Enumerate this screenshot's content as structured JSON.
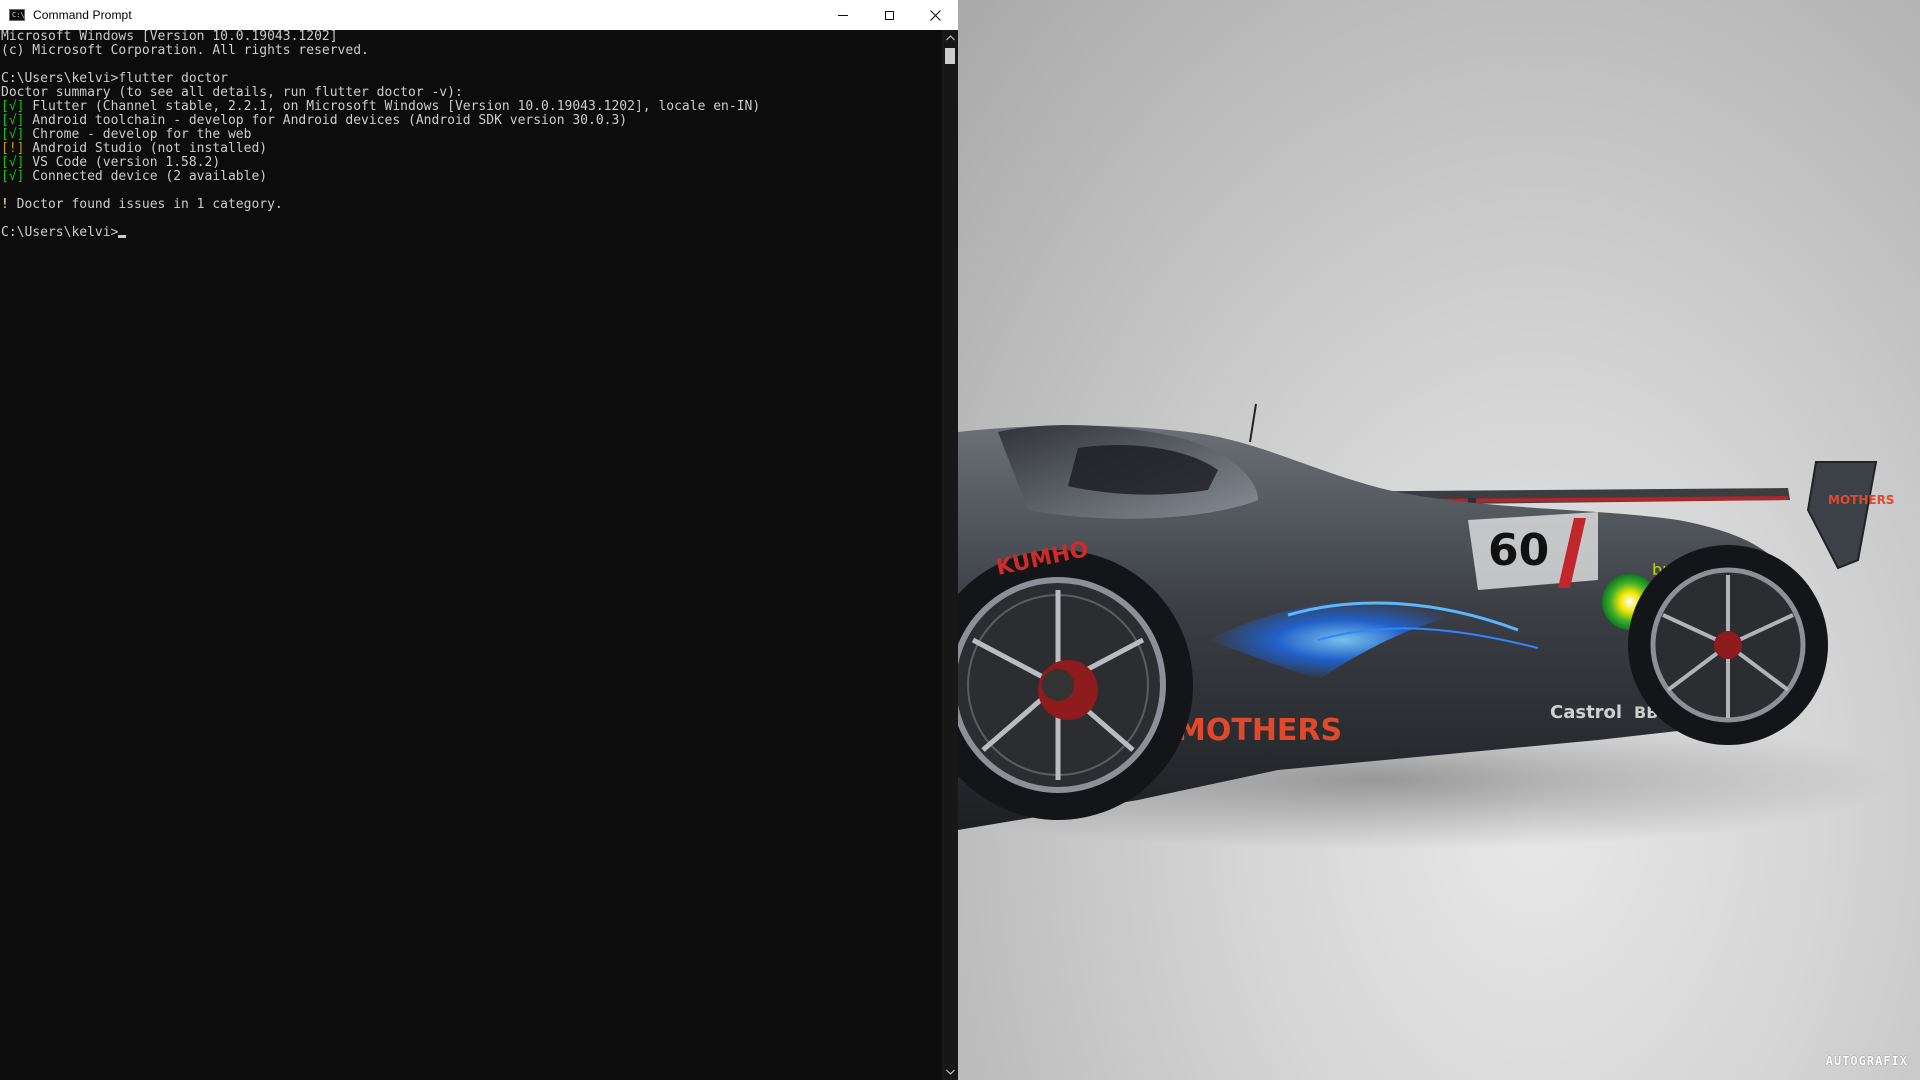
{
  "window": {
    "title": "Command Prompt",
    "icon_label": "C:\\",
    "controls": {
      "minimize": "minimize-icon",
      "maximize": "maximize-icon",
      "close": "close-icon"
    }
  },
  "console": {
    "lines": [
      {
        "text": "Microsoft Windows [Version 10.0.19043.1202]"
      },
      {
        "text": "(c) Microsoft Corporation. All rights reserved."
      },
      {
        "text": ""
      },
      {
        "text": "C:\\Users\\kelvi>flutter doctor"
      },
      {
        "text": "Doctor summary (to see all details, run flutter doctor -v):"
      },
      {
        "mark": "[√]",
        "status": "ok",
        "text": " Flutter (Channel stable, 2.2.1, on Microsoft Windows [Version 10.0.19043.1202], locale en-IN)"
      },
      {
        "mark": "[√]",
        "status": "ok",
        "text": " Android toolchain - develop for Android devices (Android SDK version 30.0.3)"
      },
      {
        "mark": "[√]",
        "status": "ok",
        "text": " Chrome - develop for the web"
      },
      {
        "mark": "[!]",
        "status": "warn",
        "text": " Android Studio (not installed)"
      },
      {
        "mark": "[√]",
        "status": "ok",
        "text": " VS Code (version 1.58.2)"
      },
      {
        "mark": "[√]",
        "status": "ok",
        "text": " Connected device (2 available)"
      },
      {
        "text": ""
      },
      {
        "mark": "!",
        "status": "warnbang",
        "text": " Doctor found issues in 1 category."
      },
      {
        "text": ""
      }
    ],
    "prompt": "C:\\Users\\kelvi>"
  },
  "colors": {
    "console_bg": "#0c0c0c",
    "console_fg": "#cccccc",
    "ok": "#16c60c",
    "warn": "#c19c00"
  },
  "wallpaper": {
    "subject": "gray race concept car",
    "logos": [
      "MOTHERS",
      "bp",
      "KUMHO",
      "Castrol",
      "BBS"
    ],
    "car_number": "60",
    "watermark": "AUTOGRAFIX"
  }
}
